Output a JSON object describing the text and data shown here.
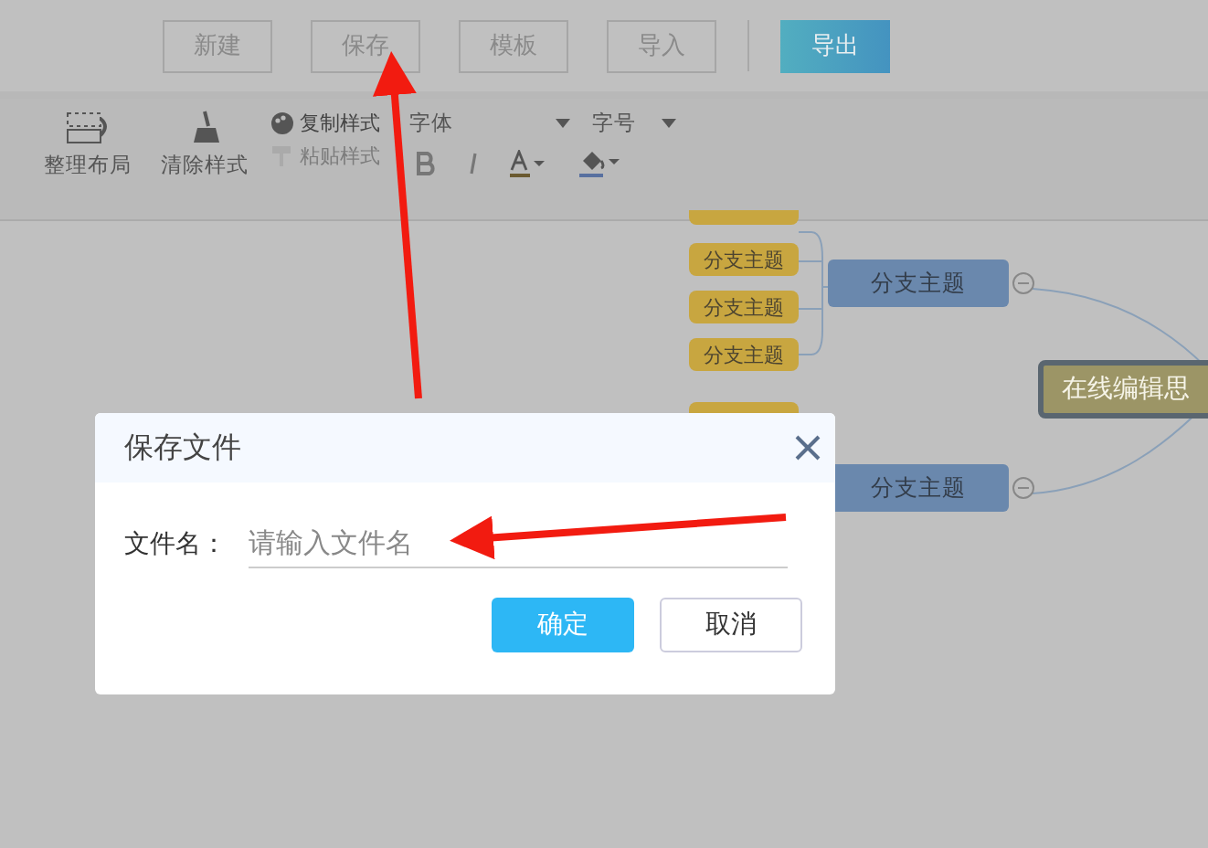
{
  "header": {
    "buttons": [
      {
        "label": "新建",
        "kind": "plain"
      },
      {
        "label": "保存",
        "kind": "plain"
      },
      {
        "label": "模板",
        "kind": "plain"
      },
      {
        "label": "导入",
        "kind": "plain"
      },
      {
        "label": "导出",
        "kind": "primary"
      }
    ]
  },
  "toolbar": {
    "layout": "整理布局",
    "clear_style": "清除样式",
    "copy_style": {
      "label": "复制样式",
      "disabled": false
    },
    "paste_style": {
      "label": "粘贴样式",
      "disabled": true
    },
    "font": "字体",
    "font_size": "字号"
  },
  "mindmap": {
    "center": "在线编辑思",
    "branches": [
      {
        "label": "分支主题",
        "expanded": true,
        "children": [
          "分支主题",
          "分支主题",
          "分支主题"
        ]
      },
      {
        "label": "分支主题",
        "expanded": true
      }
    ]
  },
  "dialog": {
    "title": "保存文件",
    "field_label": "文件名：",
    "placeholder": "请输入文件名",
    "buttons": [
      {
        "label": "确定",
        "kind": "primary"
      },
      {
        "label": "取消",
        "kind": "plain"
      }
    ]
  }
}
